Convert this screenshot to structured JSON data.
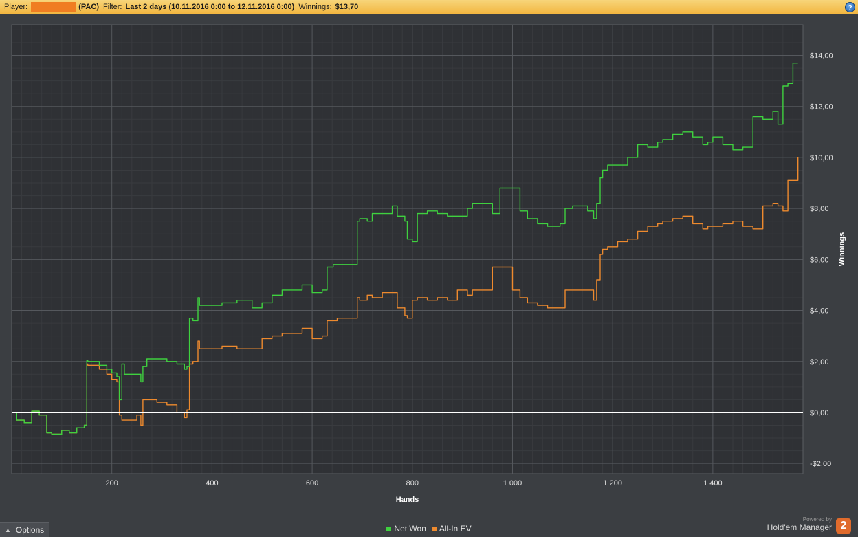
{
  "header": {
    "player_label": "Player:",
    "player_suffix": "(PAC)",
    "filter_label": "Filter:",
    "filter_value": "Last 2 days (10.11.2016 0:00 to 12.11.2016 0:00)",
    "winnings_label": "Winnings:",
    "winnings_value": "$13,70",
    "help_icon": "?"
  },
  "footer": {
    "options_label": "Options",
    "powered_by": "Powered by",
    "brand_name": "Hold'em Manager",
    "brand_logo": "2"
  },
  "colors": {
    "net_won": "#3fd13f",
    "all_in_ev": "#ee8a2e",
    "zero_line": "#ffffff",
    "accent": "#f2b640"
  },
  "chart_data": {
    "type": "line",
    "title": "",
    "xlabel": "Hands",
    "ylabel": "Winnings",
    "xlim": [
      0,
      1580
    ],
    "ylim": [
      -2.4,
      15.2
    ],
    "x_ticks": [
      200,
      400,
      600,
      800,
      1000,
      1200,
      1400
    ],
    "x_tick_labels": [
      "200",
      "400",
      "600",
      "800",
      "1 000",
      "1 200",
      "1 400"
    ],
    "y_ticks": [
      -2,
      0,
      2,
      4,
      6,
      8,
      10,
      12,
      14
    ],
    "y_tick_labels": [
      "-$2,00",
      "$0,00",
      "$2,00",
      "$4,00",
      "$6,00",
      "$8,00",
      "$10,00",
      "$12,00",
      "$14,00"
    ],
    "grid": true,
    "legend_position": "bottom-center",
    "series": [
      {
        "name": "Net Won",
        "color": "#3fd13f",
        "x": [
          0,
          10,
          25,
          40,
          55,
          70,
          80,
          100,
          115,
          130,
          145,
          150,
          152,
          175,
          190,
          200,
          210,
          215,
          220,
          225,
          230,
          250,
          258,
          262,
          270,
          290,
          310,
          330,
          345,
          350,
          355,
          362,
          372,
          375,
          380,
          400,
          420,
          450,
          480,
          500,
          520,
          540,
          560,
          580,
          600,
          620,
          630,
          642,
          650,
          660,
          670,
          690,
          695,
          710,
          720,
          740,
          760,
          770,
          785,
          790,
          800,
          810,
          830,
          850,
          870,
          890,
          910,
          920,
          960,
          975,
          1000,
          1015,
          1030,
          1050,
          1070,
          1095,
          1105,
          1120,
          1150,
          1162,
          1168,
          1175,
          1180,
          1190,
          1210,
          1230,
          1250,
          1270,
          1290,
          1300,
          1320,
          1340,
          1360,
          1380,
          1390,
          1400,
          1420,
          1440,
          1460,
          1480,
          1500,
          1520,
          1530,
          1540,
          1550,
          1560,
          1570
        ],
        "y": [
          0.0,
          -0.3,
          -0.4,
          0.05,
          -0.1,
          -0.8,
          -0.85,
          -0.7,
          -0.8,
          -0.6,
          -0.5,
          2.05,
          2.0,
          1.85,
          1.7,
          1.55,
          1.4,
          0.5,
          1.9,
          1.5,
          1.5,
          1.5,
          1.2,
          1.8,
          2.1,
          2.1,
          2.0,
          1.9,
          1.7,
          1.8,
          3.7,
          3.6,
          4.5,
          4.2,
          4.2,
          4.2,
          4.3,
          4.4,
          4.1,
          4.3,
          4.6,
          4.8,
          4.8,
          5.0,
          4.7,
          4.8,
          5.7,
          5.8,
          5.8,
          5.8,
          5.8,
          7.5,
          7.6,
          7.5,
          7.8,
          7.8,
          8.1,
          7.7,
          7.5,
          6.8,
          6.7,
          7.8,
          7.9,
          7.8,
          7.7,
          7.7,
          8.0,
          8.2,
          7.8,
          8.8,
          8.8,
          7.9,
          7.6,
          7.4,
          7.3,
          7.4,
          8.0,
          8.1,
          7.9,
          7.6,
          8.2,
          9.2,
          9.5,
          9.7,
          9.7,
          10.0,
          10.5,
          10.4,
          10.6,
          10.7,
          10.9,
          11.0,
          10.8,
          10.5,
          10.6,
          10.8,
          10.5,
          10.3,
          10.4,
          11.6,
          11.5,
          11.8,
          11.3,
          12.8,
          12.9,
          13.7,
          13.7
        ]
      },
      {
        "name": "All-In EV",
        "color": "#ee8a2e",
        "x": [
          0,
          10,
          25,
          40,
          55,
          70,
          80,
          100,
          115,
          130,
          145,
          150,
          152,
          175,
          190,
          200,
          210,
          215,
          220,
          230,
          250,
          258,
          262,
          270,
          290,
          310,
          330,
          345,
          350,
          355,
          362,
          372,
          375,
          380,
          400,
          420,
          450,
          480,
          500,
          520,
          540,
          560,
          580,
          600,
          620,
          630,
          642,
          650,
          670,
          690,
          695,
          710,
          720,
          740,
          760,
          770,
          785,
          790,
          800,
          810,
          830,
          850,
          870,
          890,
          910,
          920,
          960,
          975,
          1000,
          1015,
          1030,
          1050,
          1070,
          1095,
          1105,
          1120,
          1150,
          1162,
          1168,
          1175,
          1180,
          1190,
          1210,
          1230,
          1250,
          1270,
          1290,
          1300,
          1320,
          1340,
          1360,
          1380,
          1390,
          1400,
          1420,
          1440,
          1460,
          1480,
          1500,
          1520,
          1530,
          1540,
          1550,
          1560,
          1570
        ],
        "y": [
          0.0,
          -0.3,
          -0.4,
          0.05,
          -0.1,
          -0.8,
          -0.85,
          -0.7,
          -0.8,
          -0.6,
          -0.5,
          1.9,
          1.85,
          1.7,
          1.5,
          1.3,
          1.2,
          -0.1,
          -0.3,
          -0.3,
          -0.1,
          -0.5,
          0.5,
          0.5,
          0.4,
          0.3,
          0.0,
          -0.2,
          0.1,
          1.9,
          2.0,
          2.8,
          2.5,
          2.5,
          2.5,
          2.6,
          2.5,
          2.5,
          2.9,
          3.0,
          3.1,
          3.1,
          3.3,
          2.9,
          3.0,
          3.6,
          3.6,
          3.7,
          3.7,
          4.5,
          4.4,
          4.6,
          4.5,
          4.7,
          4.7,
          4.1,
          3.8,
          3.7,
          4.4,
          4.5,
          4.4,
          4.5,
          4.4,
          4.8,
          4.6,
          4.8,
          5.7,
          5.7,
          4.8,
          4.5,
          4.3,
          4.2,
          4.1,
          4.1,
          4.8,
          4.8,
          4.8,
          4.4,
          5.2,
          6.2,
          6.4,
          6.5,
          6.7,
          6.8,
          7.1,
          7.3,
          7.4,
          7.5,
          7.6,
          7.7,
          7.4,
          7.2,
          7.3,
          7.3,
          7.4,
          7.5,
          7.3,
          7.2,
          8.1,
          8.2,
          8.1,
          7.9,
          9.1,
          9.1,
          10.0
        ]
      }
    ],
    "reference_line": {
      "y": 0,
      "color": "#ffffff"
    }
  }
}
